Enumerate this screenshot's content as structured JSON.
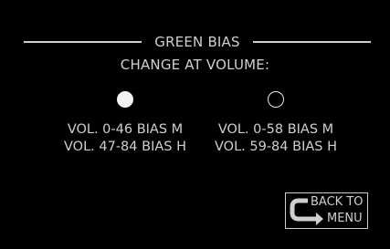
{
  "header": {
    "title": "GREEN BIAS",
    "subtitle": "CHANGE AT VOLUME:"
  },
  "options": [
    {
      "selected": true,
      "line1": "VOL. 0-46 BIAS M",
      "line2": "VOL. 47-84 BIAS H"
    },
    {
      "selected": false,
      "line1": "VOL. 0-58 BIAS M",
      "line2": "VOL. 59-84 BIAS H"
    }
  ],
  "back_button": {
    "line1": "BACK TO",
    "line2": "MENU",
    "icon": "return-arrow-icon"
  },
  "colors": {
    "background": "#000000",
    "foreground": "#cfcfcf",
    "radio_fill": "#f2f2f2"
  }
}
